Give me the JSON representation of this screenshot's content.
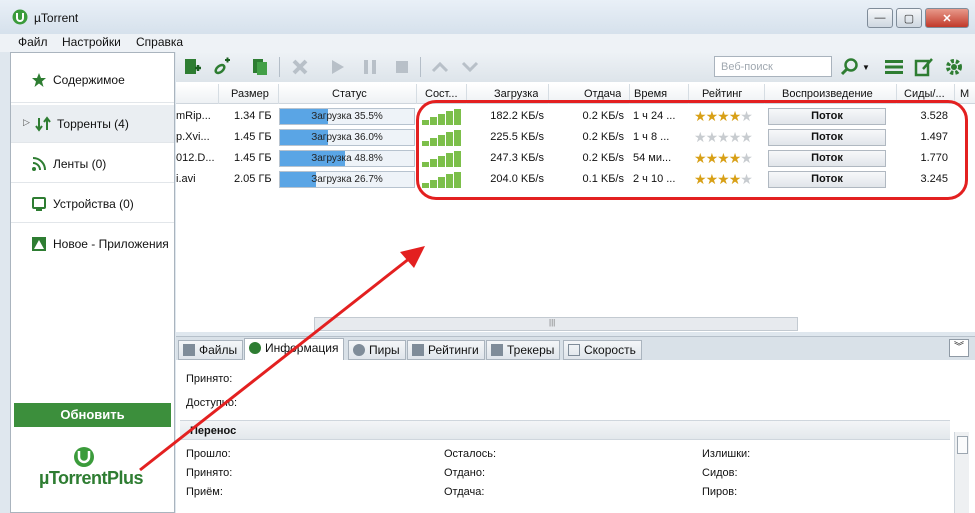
{
  "window": {
    "title": "µTorrent",
    "min": "—",
    "max": "▢",
    "close": "✕"
  },
  "menu": [
    "Файл",
    "Настройки",
    "Справка"
  ],
  "sidebar": {
    "items": [
      {
        "label": "Содержимое",
        "icon": "star-icon"
      },
      {
        "label": "Торренты (4)",
        "icon": "transfer-arrows-icon"
      },
      {
        "label": "Ленты (0)",
        "icon": "rss-icon"
      },
      {
        "label": "Устройства (0)",
        "icon": "device-icon"
      },
      {
        "label": "Новое - Приложения",
        "icon": "apps-icon"
      }
    ],
    "update_label": "Обновить",
    "logo_text": "µTorrentPlus"
  },
  "toolbar": {
    "search_placeholder": "Веб-поиск"
  },
  "columns": [
    "Размер",
    "Статус",
    "Сост...",
    "Загрузка",
    "Отдача",
    "Время",
    "Рейтинг",
    "Воспроизведение",
    "Сиды/...",
    "М"
  ],
  "torrents": [
    {
      "name": "mRip...",
      "size": "1.34 ГБ",
      "status": "Загрузка 35.5%",
      "progress": 35.5,
      "health": 5,
      "down": "182.2 KБ/s",
      "up": "0.2 KБ/s",
      "time": "1 ч 24 ...",
      "rating": 4,
      "play": "Поток",
      "seeds": "3.528"
    },
    {
      "name": "p.Xvi...",
      "size": "1.45 ГБ",
      "status": "Загрузка 36.0%",
      "progress": 36.0,
      "health": 5,
      "down": "225.5 KБ/s",
      "up": "0.2 KБ/s",
      "time": "1 ч 8 ...",
      "rating": 0,
      "play": "Поток",
      "seeds": "1.497"
    },
    {
      "name": "012.D...",
      "size": "1.45 ГБ",
      "status": "Загрузка 48.8%",
      "progress": 48.8,
      "health": 5,
      "down": "247.3 KБ/s",
      "up": "0.2 KБ/s",
      "time": "54 ми...",
      "rating": 4,
      "play": "Поток",
      "seeds": "1.770"
    },
    {
      "name": "i.avi",
      "size": "2.05 ГБ",
      "status": "Загрузка 26.7%",
      "progress": 26.7,
      "health": 5,
      "down": "204.0 KБ/s",
      "up": "0.1 KБ/s",
      "time": "2 ч 10 ...",
      "rating": 4,
      "play": "Поток",
      "seeds": "3.245"
    }
  ],
  "detail_tabs": [
    "Файлы",
    "Информация",
    "Пиры",
    "Рейтинги",
    "Трекеры",
    "Скорость"
  ],
  "detail": {
    "received_label": "Принято:",
    "reached_label": "Доступно:",
    "section_title": "Перенос",
    "fields": [
      [
        "Прошло:",
        "Осталось:",
        "Излишки:"
      ],
      [
        "Принято:",
        "Отдано:",
        "Сидов:"
      ],
      [
        "Приём:",
        "Отдача:",
        "Пиров:"
      ]
    ]
  },
  "colors": {
    "highlight": "#e32020",
    "brand_green": "#3c8f3c",
    "progress": "#5aa5e5"
  }
}
